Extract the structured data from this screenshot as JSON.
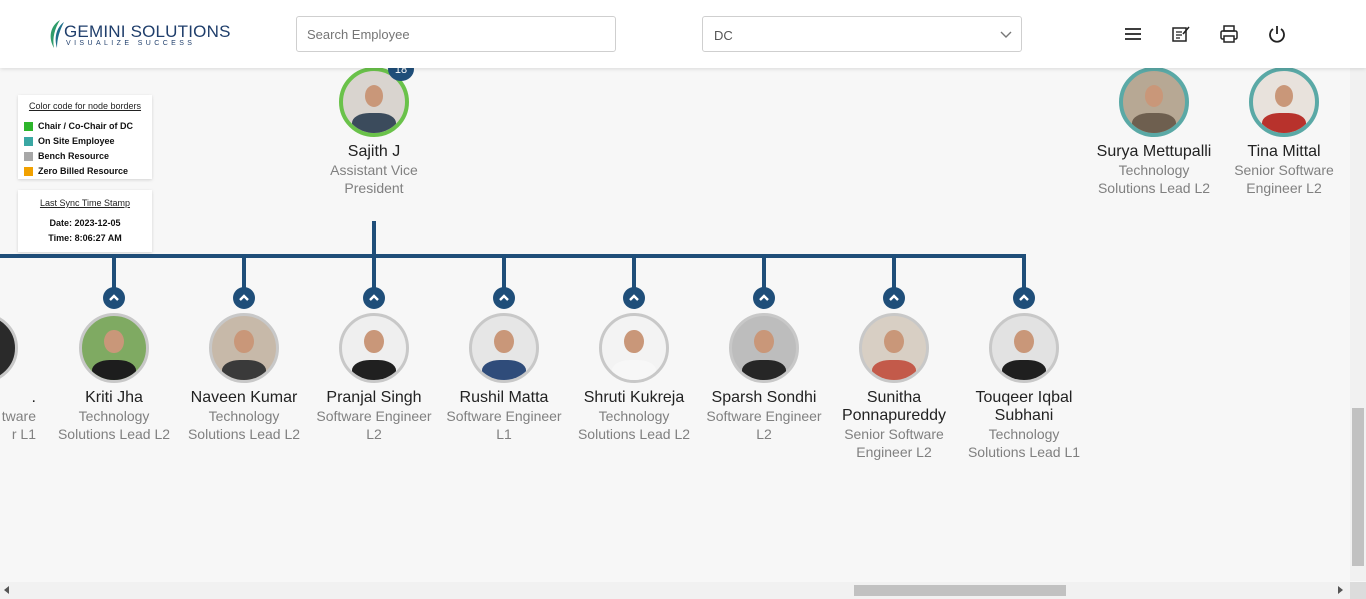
{
  "header": {
    "logo_main": "GEMINI SOLUTIONS",
    "logo_tagline": "VISUALIZE SUCCESS",
    "search_placeholder": "Search Employee",
    "dc_select_value": "DC",
    "icons": [
      "menu-icon",
      "notes-icon",
      "print-icon",
      "power-icon"
    ]
  },
  "legend": {
    "title": "Color code for node borders",
    "items": [
      {
        "label": "Chair / Co-Chair of DC",
        "color": "#2db52b"
      },
      {
        "label": "On Site Employee",
        "color": "#3aa7a3"
      },
      {
        "label": "Bench Resource",
        "color": "#a7a7a7"
      },
      {
        "label": "Zero Billed Resource",
        "color": "#f1a100"
      }
    ]
  },
  "sync": {
    "title": "Last Sync Time Stamp",
    "date_line": "Date: 2023-12-05",
    "time_line": "Time: 8:06:27 AM"
  },
  "root": {
    "name": "Sajith J",
    "title": "Assistant Vice President",
    "count_badge": "18",
    "border": "green"
  },
  "top_right": [
    {
      "name": "Surya Mettupalli",
      "title": "Technology Solutions Lead L2",
      "border": "teal"
    },
    {
      "name": "Tina Mittal",
      "title": "Senior Software Engineer L2",
      "border": "teal"
    }
  ],
  "partial_left": {
    "name": ".",
    "title_line1": "tware",
    "title_line2": "r L1"
  },
  "children": [
    {
      "name": "Kriti Jha",
      "title": "Technology Solutions Lead L2"
    },
    {
      "name": "Naveen Kumar",
      "title": "Technology Solutions Lead L2"
    },
    {
      "name": "Pranjal Singh",
      "title": "Software Engineer L2"
    },
    {
      "name": "Rushil Matta",
      "title": "Software Engineer L1"
    },
    {
      "name": "Shruti Kukreja",
      "title": "Technology Solutions Lead L2"
    },
    {
      "name": "Sparsh Sondhi",
      "title": "Software Engineer L2"
    },
    {
      "name": "Sunitha Ponnapureddy",
      "title": "Senior Software Engineer L2"
    },
    {
      "name": "Touqeer Iqbal Subhani",
      "title": "Technology Solutions Lead L1"
    }
  ],
  "colors": {
    "connector": "#1f4e79",
    "header_bg": "#ffffff",
    "canvas_bg": "#f7f7f7"
  }
}
